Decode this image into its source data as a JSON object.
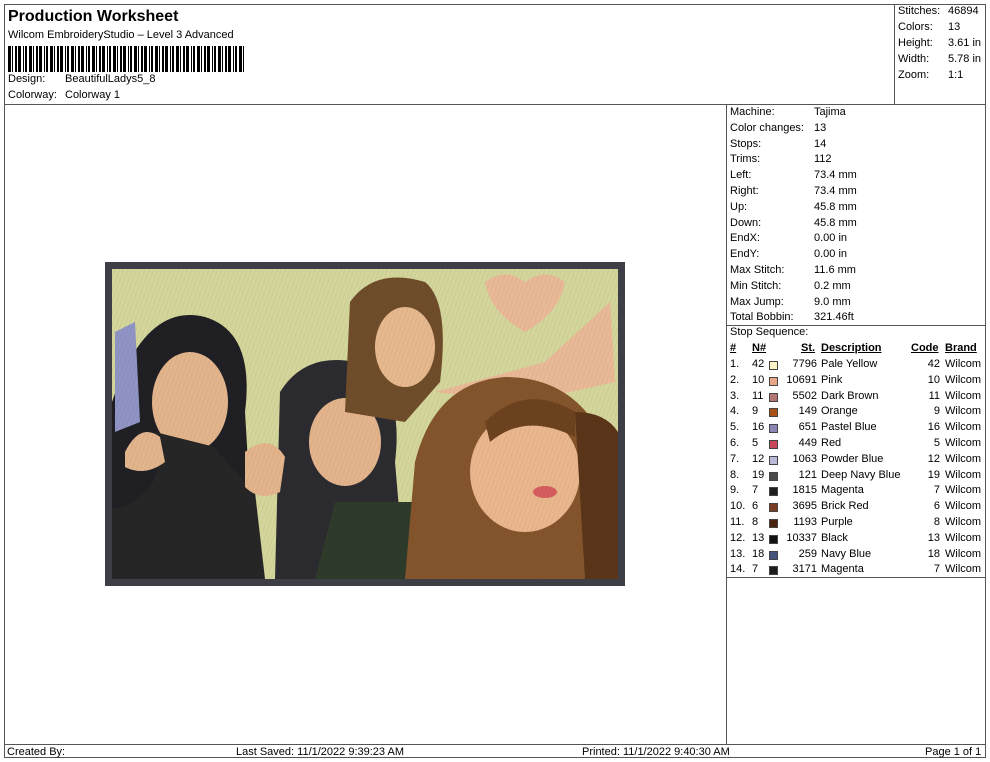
{
  "header": {
    "title": "Production Worksheet",
    "subtitle": "Wilcom EmbroideryStudio – Level 3 Advanced",
    "design_label": "Design:",
    "design_value": "BeautifulLadys5_8",
    "colorway_label": "Colorway:",
    "colorway_value": "Colorway 1"
  },
  "stats": [
    {
      "label": "Stitches:",
      "value": "46894"
    },
    {
      "label": "Colors:",
      "value": "13"
    },
    {
      "label": "Height:",
      "value": "3.61 in"
    },
    {
      "label": "Width:",
      "value": "5.78 in"
    },
    {
      "label": "Zoom:",
      "value": "1:1"
    }
  ],
  "machine_info": [
    {
      "label": "Machine:",
      "value": "Tajima"
    },
    {
      "label": "Color changes:",
      "value": "13"
    },
    {
      "label": "Stops:",
      "value": "14"
    },
    {
      "label": "Trims:",
      "value": "112"
    },
    {
      "label": "Left:",
      "value": "73.4 mm"
    },
    {
      "label": "Right:",
      "value": "73.4 mm"
    },
    {
      "label": "Up:",
      "value": "45.8 mm"
    },
    {
      "label": "Down:",
      "value": "45.8 mm"
    },
    {
      "label": "EndX:",
      "value": "0.00 in"
    },
    {
      "label": "EndY:",
      "value": "0.00 in"
    },
    {
      "label": "Max Stitch:",
      "value": "11.6 mm"
    },
    {
      "label": "Min Stitch:",
      "value": "0.2 mm"
    },
    {
      "label": "Max Jump:",
      "value": "9.0 mm"
    },
    {
      "label": "Total Bobbin:",
      "value": "321.46ft"
    }
  ],
  "stop_sequence": {
    "title": "Stop Sequence:",
    "headers": {
      "num": "#",
      "n": "N#",
      "st": "St.",
      "desc": "Description",
      "code": "Code",
      "brand": "Brand"
    },
    "rows": [
      {
        "num": "1.",
        "n": "42",
        "color": "#fdf3c4",
        "st": "7796",
        "desc": "Pale Yellow",
        "code": "42",
        "brand": "Wilcom"
      },
      {
        "num": "2.",
        "n": "10",
        "color": "#e9a689",
        "st": "10691",
        "desc": "Pink",
        "code": "10",
        "brand": "Wilcom"
      },
      {
        "num": "3.",
        "n": "11",
        "color": "#b27772",
        "st": "5502",
        "desc": "Dark Brown",
        "code": "11",
        "brand": "Wilcom"
      },
      {
        "num": "4.",
        "n": "9",
        "color": "#a85117",
        "st": "149",
        "desc": "Orange",
        "code": "9",
        "brand": "Wilcom"
      },
      {
        "num": "5.",
        "n": "16",
        "color": "#8a86b8",
        "st": "651",
        "desc": "Pastel Blue",
        "code": "16",
        "brand": "Wilcom"
      },
      {
        "num": "6.",
        "n": "5",
        "color": "#c8485a",
        "st": "449",
        "desc": "Red",
        "code": "5",
        "brand": "Wilcom"
      },
      {
        "num": "7.",
        "n": "12",
        "color": "#b7b9d6",
        "st": "1063",
        "desc": "Powder Blue",
        "code": "12",
        "brand": "Wilcom"
      },
      {
        "num": "8.",
        "n": "19",
        "color": "#4a4a4a",
        "st": "121",
        "desc": "Deep Navy Blue",
        "code": "19",
        "brand": "Wilcom"
      },
      {
        "num": "9.",
        "n": "7",
        "color": "#1d1d1d",
        "st": "1815",
        "desc": "Magenta",
        "code": "7",
        "brand": "Wilcom"
      },
      {
        "num": "10.",
        "n": "6",
        "color": "#7a3c24",
        "st": "3695",
        "desc": "Brick Red",
        "code": "6",
        "brand": "Wilcom"
      },
      {
        "num": "11.",
        "n": "8",
        "color": "#4a2210",
        "st": "1193",
        "desc": "Purple",
        "code": "8",
        "brand": "Wilcom"
      },
      {
        "num": "12.",
        "n": "13",
        "color": "#111111",
        "st": "10337",
        "desc": "Black",
        "code": "13",
        "brand": "Wilcom"
      },
      {
        "num": "13.",
        "n": "18",
        "color": "#46557f",
        "st": "259",
        "desc": "Navy Blue",
        "code": "18",
        "brand": "Wilcom"
      },
      {
        "num": "14.",
        "n": "7",
        "color": "#1d1d1d",
        "st": "3171",
        "desc": "Magenta",
        "code": "7",
        "brand": "Wilcom"
      }
    ]
  },
  "footer": {
    "created_by": "Created By:",
    "last_saved": "Last Saved: 11/1/2022 9:39:23 AM",
    "printed": "Printed: 11/1/2022 9:40:30 AM",
    "page": "Page 1 of 1"
  }
}
